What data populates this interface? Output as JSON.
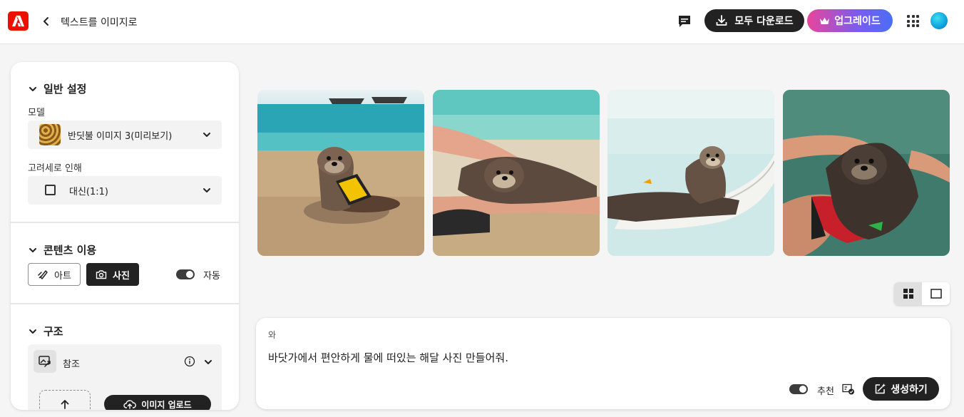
{
  "header": {
    "app_icon": "adobe-logo-icon",
    "breadcrumb": "텍스트를 이미지로",
    "download_all_label": "모두 다운로드",
    "upgrade_label": "업그레이드"
  },
  "sidebar": {
    "general": {
      "title": "일반 설정",
      "model_label": "모델",
      "model_value": "반딧불 이미지 3(미리보기)",
      "ratio_label": "고려세로 인해",
      "ratio_value": "대신(1:1)"
    },
    "content_type": {
      "title": "콘텐츠 이용",
      "art_label": "아트",
      "photo_label": "사진",
      "auto_label": "자동",
      "selected": "사진"
    },
    "structure": {
      "title": "구조",
      "reference_label": "참조",
      "upload_label": "이미지 업로드"
    }
  },
  "gallery": {
    "images": [
      {
        "alt": "otter holding phone on beach"
      },
      {
        "alt": "otter lying on person on sand"
      },
      {
        "alt": "otter floating on pool float"
      },
      {
        "alt": "otter floating on person in water"
      }
    ]
  },
  "prompt": {
    "label": "와",
    "text": "바닷가에서 편안하게 물에 떠있는 해달 사진 만들어줘.",
    "recommend_label": "추천",
    "generate_label": "생성하기"
  },
  "colors": {
    "brand": "#eb1000",
    "dark": "#222222",
    "upgrade_gradient_start": "#e8459a",
    "upgrade_gradient_end": "#4a6ef5"
  }
}
